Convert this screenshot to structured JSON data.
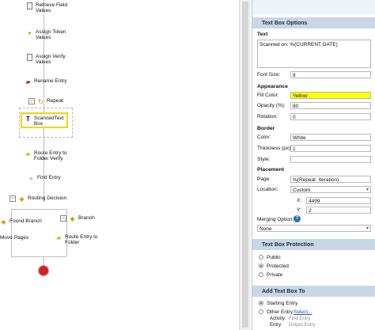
{
  "workflow": {
    "nodes": [
      {
        "id": "retrieve",
        "label1": "Retrieve Field",
        "label2": "Values"
      },
      {
        "id": "assign-token",
        "label1": "Assign Token",
        "label2": "Values"
      },
      {
        "id": "assign-verify",
        "label1": "Assign Verify",
        "label2": "Values"
      },
      {
        "id": "rename",
        "label1": "Rename Entry",
        "label2": ""
      },
      {
        "id": "repeat",
        "label1": "Repeat",
        "label2": ""
      },
      {
        "id": "scanned",
        "label1": "ScannedText",
        "label2": "Box"
      },
      {
        "id": "route-verify",
        "label1": "Route Entry to",
        "label2": "Folder Verify"
      },
      {
        "id": "find",
        "label1": "Find Entry",
        "label2": ""
      },
      {
        "id": "routing",
        "label1": "Routing Decision",
        "label2": ""
      },
      {
        "id": "found-branch",
        "label1": "Found Branch",
        "label2": ""
      },
      {
        "id": "branch",
        "label1": "Branch",
        "label2": ""
      },
      {
        "id": "move-pages",
        "label1": "Move Pages",
        "label2": ""
      },
      {
        "id": "route-folder",
        "label1": "Route Entry to",
        "label2": "Folder"
      }
    ],
    "selected_color": "#f2d500",
    "end_color": "#d62020"
  },
  "panel": {
    "options_header": "Text Box Options",
    "text_group": "Text",
    "text_value": "Scanned on: %(CURRENT DATE)",
    "font_size_label": "Font Size:",
    "font_size_value": "8",
    "appearance_group": "Appearance",
    "fill_color_label": "Fill Color:",
    "fill_color_value": "Yellow",
    "fill_color_hex": "#ffff00",
    "opacity_label": "Opacity (%):",
    "opacity_value": "80",
    "rotation_label": "Rotation:",
    "rotation_value": "0",
    "border_group": "Border",
    "border_color_label": "Color:",
    "border_color_value": "White",
    "thickness_label": "Thickness (px):",
    "thickness_value": "1",
    "style_label": "Style:",
    "style_value": "",
    "placement_group": "Placement",
    "page_label": "Page:",
    "page_value": "%(Repeat_Iteration)",
    "location_label": "Location:",
    "location_value": "Custom",
    "x_label": "X:",
    "x_value": "4499",
    "y_label": "Y:",
    "y_value": "2",
    "merging_label": "Merging Option:",
    "merging_help": "?",
    "merging_value": "None",
    "protection_header": "Text Box Protection",
    "protection_options": [
      "Public",
      "Protected",
      "Private"
    ],
    "protection_selected": "Protected",
    "add_header": "Add Text Box To",
    "add_options": [
      "Starting Entry",
      "Other Entry"
    ],
    "add_selected": "Starting Entry",
    "select_link": "Select...",
    "activity_label": "Activity:",
    "activity_value": "Find Entry",
    "entry_label": "Entry:",
    "entry_value": "Output Entry"
  }
}
